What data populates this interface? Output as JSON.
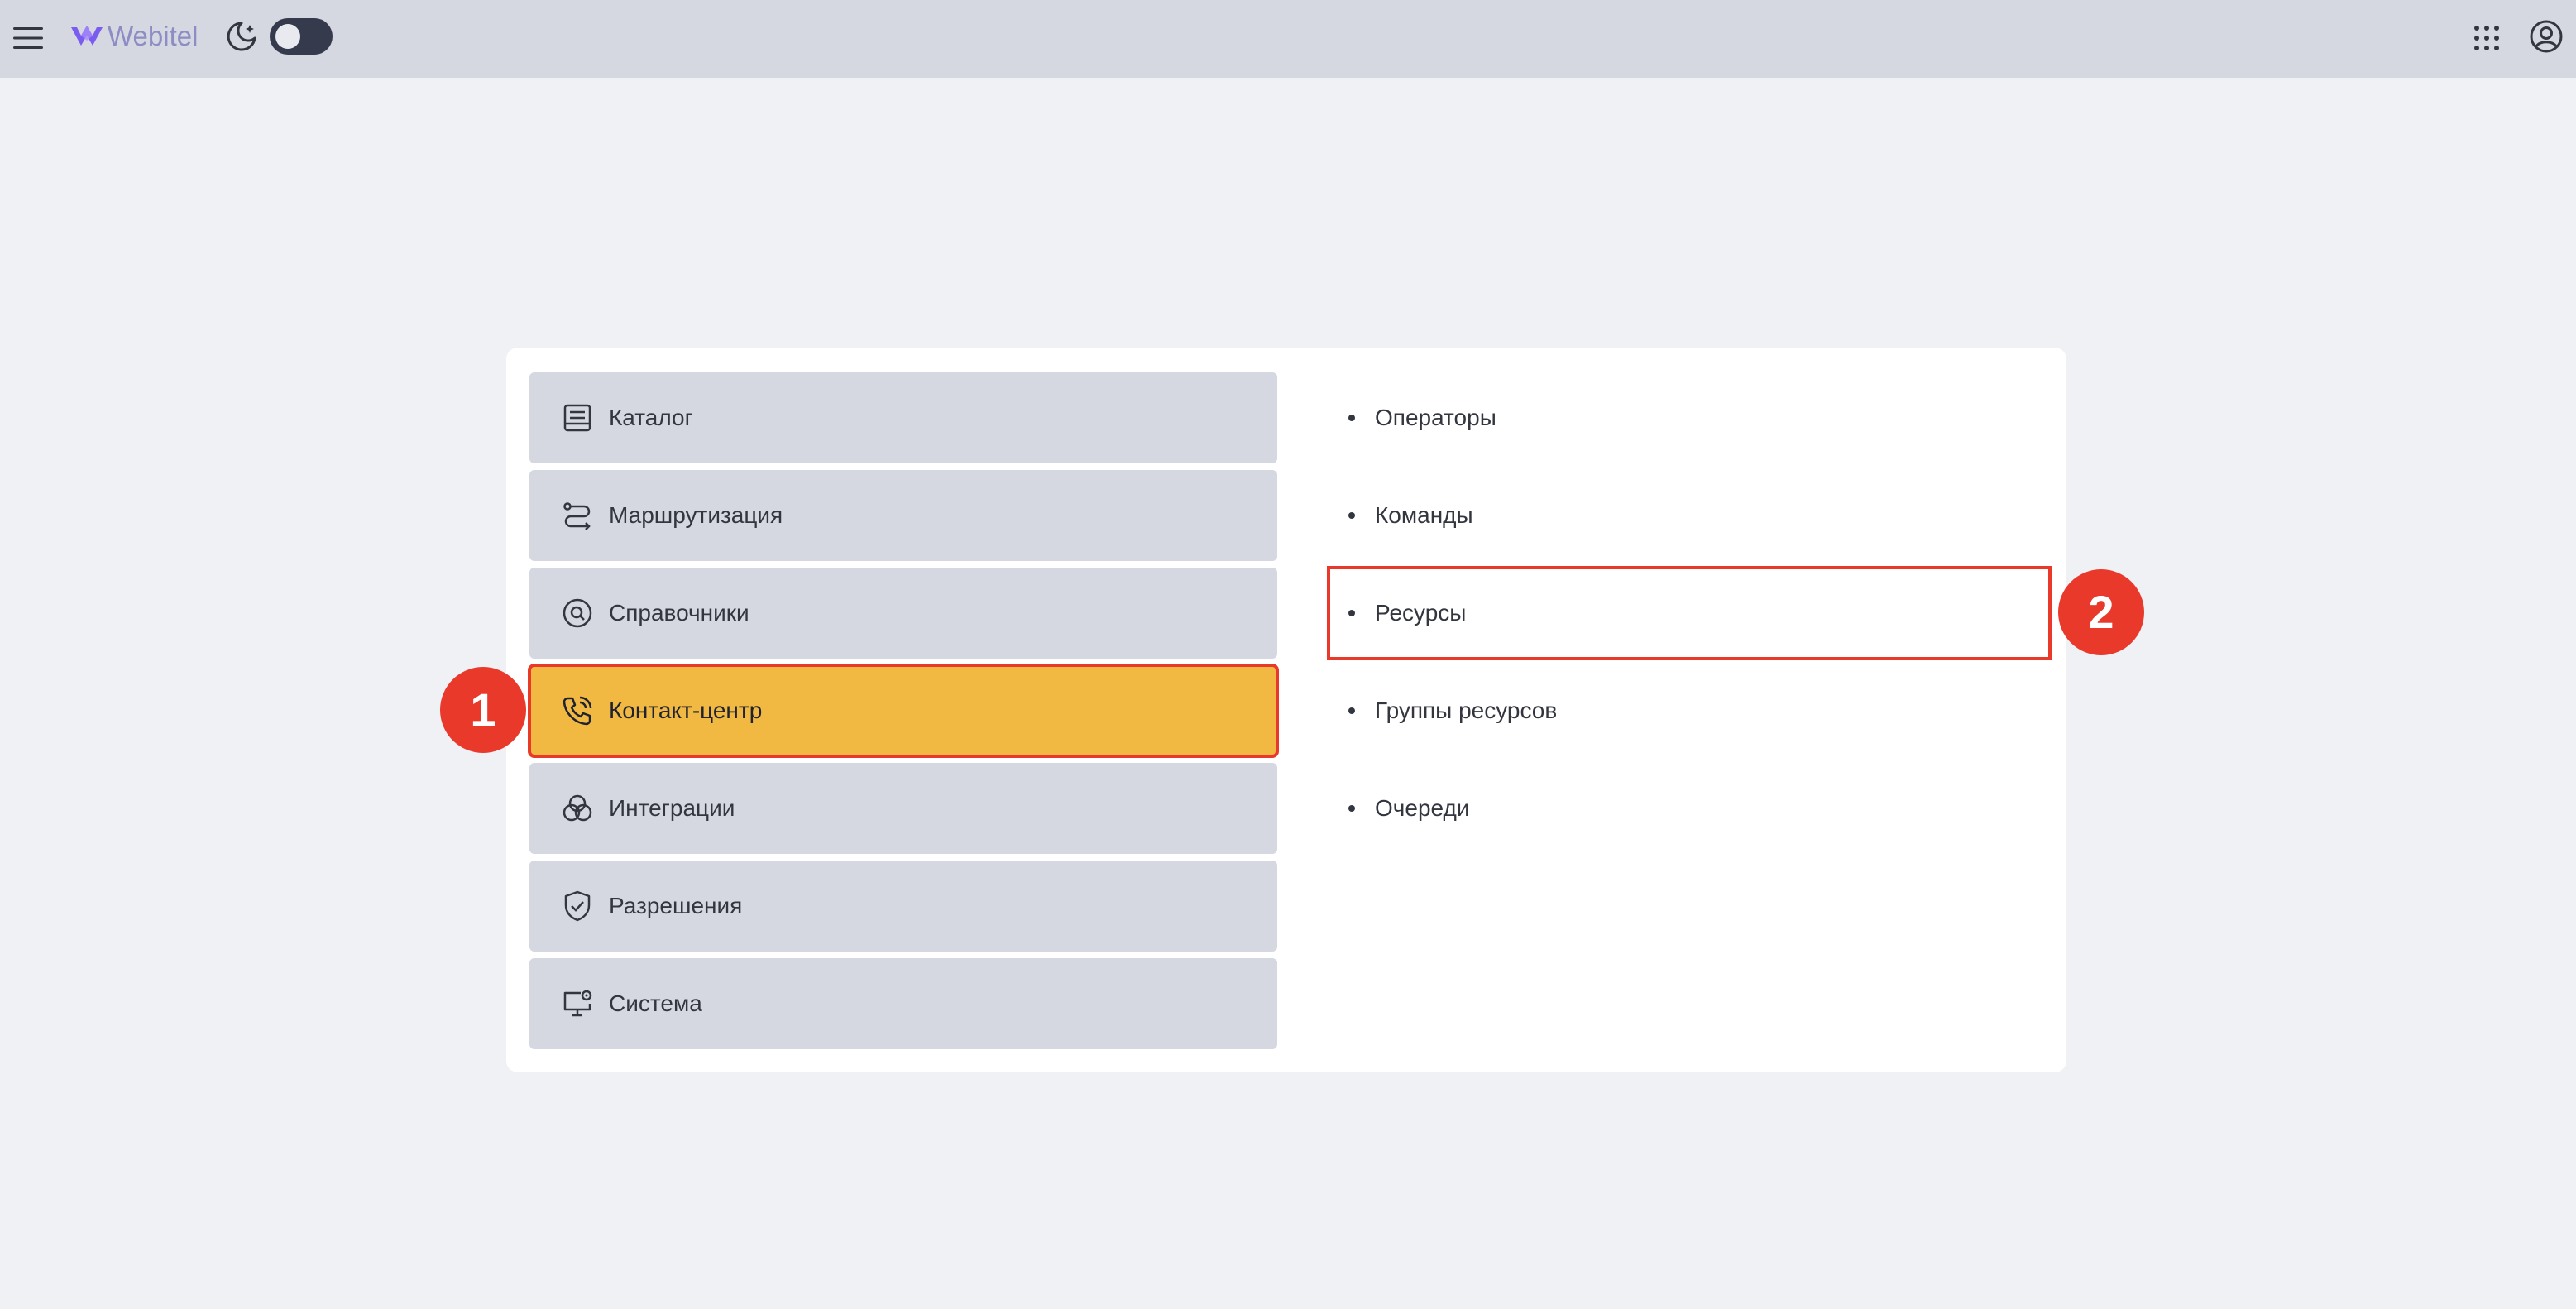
{
  "header": {
    "logo_text": "Webitel",
    "theme_toggle_on": false
  },
  "menu": {
    "items": [
      {
        "label": "Каталог",
        "icon": "catalog-icon"
      },
      {
        "label": "Маршрутизация",
        "icon": "routing-icon"
      },
      {
        "label": "Справочники",
        "icon": "directory-icon"
      },
      {
        "label": "Контакт-центр",
        "icon": "phone-icon",
        "active": true
      },
      {
        "label": "Интеграции",
        "icon": "integrations-icon"
      },
      {
        "label": "Разрешения",
        "icon": "shield-check-icon"
      },
      {
        "label": "Система",
        "icon": "system-monitor-icon"
      }
    ]
  },
  "submenu": {
    "items": [
      {
        "label": "Операторы"
      },
      {
        "label": "Команды"
      },
      {
        "label": "Ресурсы",
        "highlighted": true
      },
      {
        "label": "Группы ресурсов"
      },
      {
        "label": "Очереди"
      }
    ]
  },
  "badges": {
    "step1": "1",
    "step2": "2"
  },
  "colors": {
    "header_bg": "#d5d7e1",
    "page_bg": "#f0f1f5",
    "active_item": "#f1b942",
    "highlight_red": "#e8392b",
    "logo_purple": "#7b5cf0"
  }
}
